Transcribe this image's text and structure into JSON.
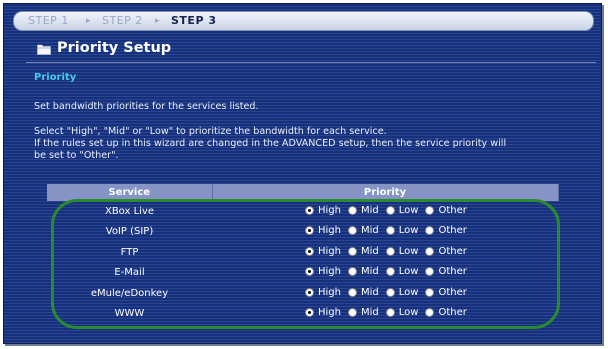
{
  "steps": [
    "STEP 1",
    "STEP 2",
    "STEP 3"
  ],
  "step_separator": "▸",
  "page_title": "Priority Setup",
  "section_heading": "Priority",
  "instructions": {
    "line1": "Set bandwidth priorities for the services listed.",
    "line2": "Select \"High\", \"Mid\" or \"Low\" to prioritize the bandwidth for each service.",
    "line3": "If the rules set up in this wizard are changed in the ADVANCED setup, then the service priority will",
    "line4": "be set to \"Other\"."
  },
  "table": {
    "headers": [
      "Service",
      "Priority"
    ],
    "options": [
      "High",
      "Mid",
      "Low",
      "Other"
    ],
    "rows": [
      {
        "service": "XBox Live",
        "selected": "High"
      },
      {
        "service": "VoIP (SIP)",
        "selected": "High"
      },
      {
        "service": "FTP",
        "selected": "High"
      },
      {
        "service": "E-Mail",
        "selected": "High"
      },
      {
        "service": "eMule/eDonkey",
        "selected": "High"
      },
      {
        "service": "WWW",
        "selected": "High"
      }
    ]
  },
  "colors": {
    "background": "#14307e",
    "section_heading": "#47c7f0",
    "table_header": "#8594c5",
    "annotation": "#2c8a2e"
  },
  "icons": {
    "title_icon": "folder-icon"
  }
}
